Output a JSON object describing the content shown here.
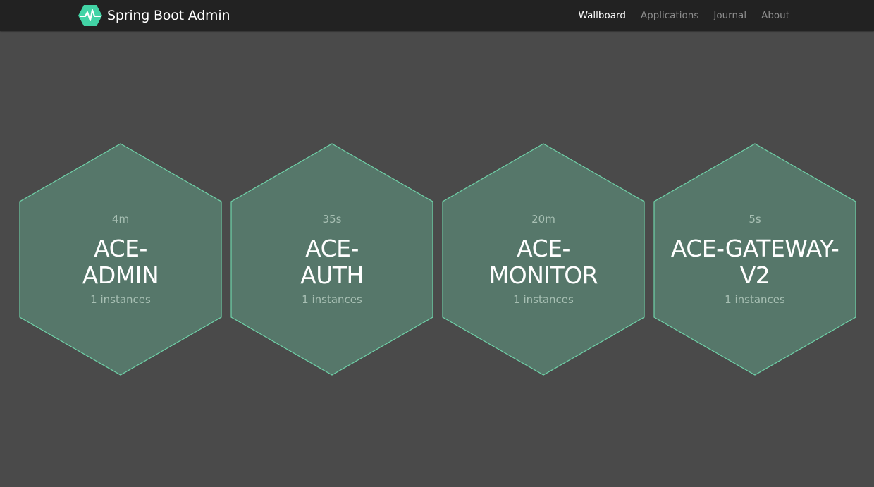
{
  "brand": {
    "title": "Spring Boot Admin",
    "logo_icon": "heartbeat-hexagon-icon",
    "logo_color": "#42d3a5"
  },
  "nav": {
    "items": [
      {
        "label": "Wallboard",
        "active": true
      },
      {
        "label": "Applications",
        "active": false
      },
      {
        "label": "Journal",
        "active": false
      },
      {
        "label": "About",
        "active": false
      }
    ]
  },
  "colors": {
    "hex_fill": "#56776a",
    "hex_stroke": "#6fd1a8",
    "background": "#4a4a4a",
    "navbar": "#222222"
  },
  "applications": [
    {
      "time": "4m",
      "name": "ACE-\nADMIN",
      "instances": "1 instances"
    },
    {
      "time": "35s",
      "name": "ACE-\nAUTH",
      "instances": "1 instances"
    },
    {
      "time": "20m",
      "name": "ACE-\nMONITOR",
      "instances": "1 instances"
    },
    {
      "time": "5s",
      "name": "ACE-GATEWAY-\nV2",
      "instances": "1 instances"
    }
  ]
}
